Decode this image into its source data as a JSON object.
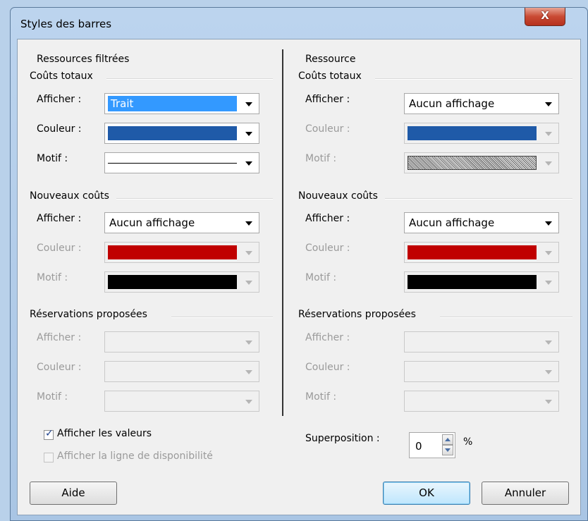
{
  "window": {
    "title": "Styles des barres",
    "close_glyph": "X"
  },
  "left": {
    "header": "Ressources filtrées",
    "groups": [
      {
        "title": "Coûts totaux",
        "show": {
          "label": "Afficher :",
          "value": "Trait"
        },
        "color": {
          "label": "Couleur :",
          "value_color": "#1f5aa8"
        },
        "pattern": {
          "label": "Motif :"
        }
      },
      {
        "title": "Nouveaux coûts",
        "show": {
          "label": "Afficher :",
          "value": "Aucun affichage"
        },
        "color": {
          "label": "Couleur :",
          "value_color": "#c00000"
        },
        "pattern": {
          "label": "Motif :"
        }
      },
      {
        "title": "Réservations proposées",
        "show": {
          "label": "Afficher :"
        },
        "color": {
          "label": "Couleur :"
        },
        "pattern": {
          "label": "Motif :"
        }
      }
    ],
    "show_values": "Afficher les valeurs",
    "show_availability": "Afficher la ligne de disponibilité"
  },
  "right": {
    "header": "Ressource",
    "groups": [
      {
        "title": "Coûts totaux",
        "show": {
          "label": "Afficher :",
          "value": "Aucun affichage"
        },
        "color": {
          "label": "Couleur :",
          "value_color": "#1f5aa8"
        },
        "pattern": {
          "label": "Motif :"
        }
      },
      {
        "title": "Nouveaux coûts",
        "show": {
          "label": "Afficher :",
          "value": "Aucun affichage"
        },
        "color": {
          "label": "Couleur :",
          "value_color": "#c00000"
        },
        "pattern": {
          "label": "Motif :"
        }
      },
      {
        "title": "Réservations proposées",
        "show": {
          "label": "Afficher :"
        },
        "color": {
          "label": "Couleur :"
        },
        "pattern": {
          "label": "Motif :"
        }
      }
    ],
    "overlap": {
      "label": "Superposition :",
      "value": "0",
      "unit": "%"
    }
  },
  "buttons": {
    "help": "Aide",
    "ok": "OK",
    "cancel": "Annuler"
  }
}
